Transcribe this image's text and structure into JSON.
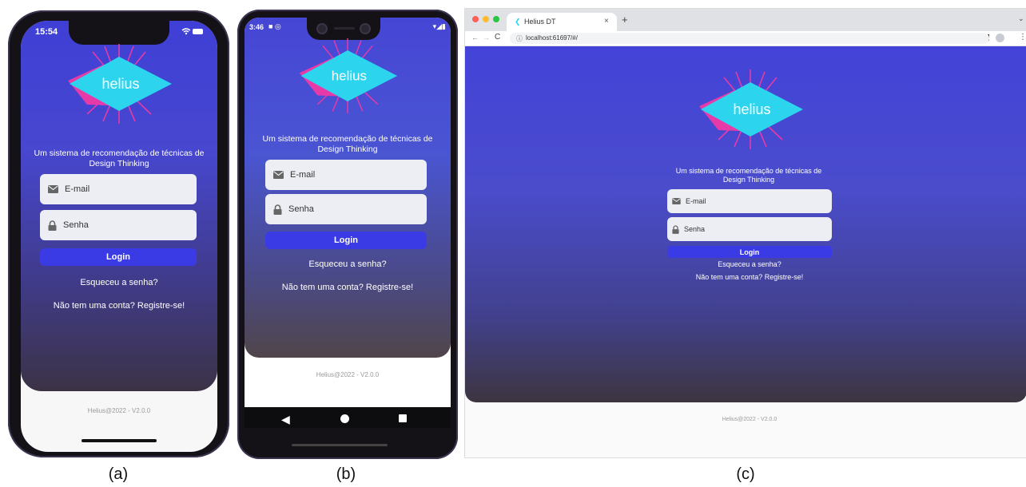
{
  "captions": [
    "(a)",
    "(b)",
    "(c)"
  ],
  "app": {
    "logo_text": "helius",
    "tagline": "Um sistema de recomendação de técnicas de Design Thinking",
    "email_placeholder": "E-mail",
    "password_placeholder": "Senha",
    "login_label": "Login",
    "forgot_label": "Esqueceu a senha?",
    "register_label": "Não tem uma conta? Registre-se!",
    "footer": "Helius@2022 - V2.0.0",
    "colors": {
      "accent": "#3b3be6",
      "bg_top": "#4343d8",
      "bg_bottom": "#3d3540",
      "logo_cyan": "#2dd4ee",
      "logo_pink": "#e63aa8"
    }
  },
  "iphone": {
    "status_time": "15:54"
  },
  "android": {
    "status_time": "3:46"
  },
  "browser": {
    "tab_title": "Helius DT",
    "url": "localhost:61697/#/"
  }
}
